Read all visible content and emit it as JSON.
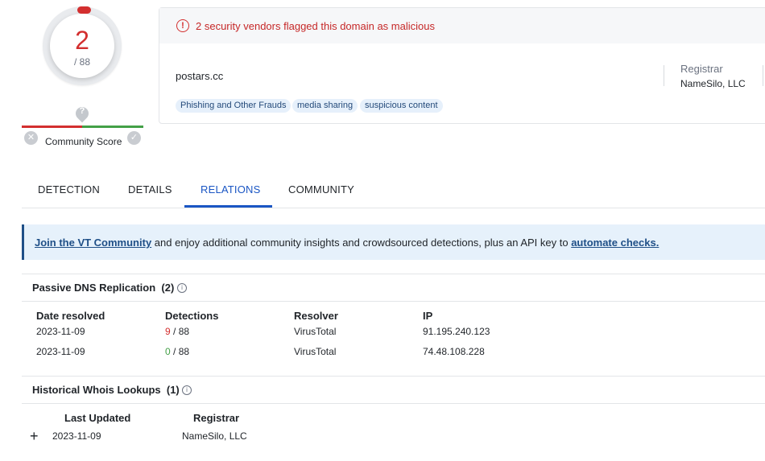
{
  "score": {
    "detections": "2",
    "total": "/ 88"
  },
  "community": {
    "label": "Community Score",
    "help_glyph": "?",
    "down_glyph": "✕",
    "up_glyph": "✓"
  },
  "alert": {
    "icon": "!",
    "text": "2 security vendors flagged this domain as malicious"
  },
  "domain": "postars.cc",
  "tags": [
    "Phishing and Other Frauds",
    "media sharing",
    "suspicious content"
  ],
  "registrar": {
    "label": "Registrar",
    "value": "NameSilo, LLC"
  },
  "tabs": [
    "DETECTION",
    "DETAILS",
    "RELATIONS",
    "COMMUNITY"
  ],
  "active_tab": "RELATIONS",
  "banner": {
    "link1": "Join the VT Community",
    "middle": " and enjoy additional community insights and crowdsourced detections, plus an API key to ",
    "link2": "automate checks."
  },
  "passive_dns": {
    "title": "Passive DNS Replication",
    "count": "(2)",
    "info_glyph": "i",
    "headers": [
      "Date resolved",
      "Detections",
      "Resolver",
      "IP"
    ],
    "rows": [
      {
        "date": "2023-11-09",
        "det": "9",
        "det_total": " / 88",
        "resolver": "VirusTotal",
        "ip": "91.195.240.123"
      },
      {
        "date": "2023-11-09",
        "det": "0",
        "det_total": " / 88",
        "resolver": "VirusTotal",
        "ip": "74.48.108.228"
      }
    ]
  },
  "whois": {
    "title": "Historical Whois Lookups",
    "count": "(1)",
    "info_glyph": "i",
    "expand_glyph": "+",
    "headers": [
      "Last Updated",
      "Registrar"
    ],
    "rows": [
      {
        "updated": "2023-11-09",
        "registrar": "NameSilo, LLC"
      }
    ]
  },
  "colors": {
    "malicious": "#d32f2f",
    "clean": "#43a047",
    "accent": "#1a56c4",
    "banner_bg": "#e6f1fb"
  }
}
